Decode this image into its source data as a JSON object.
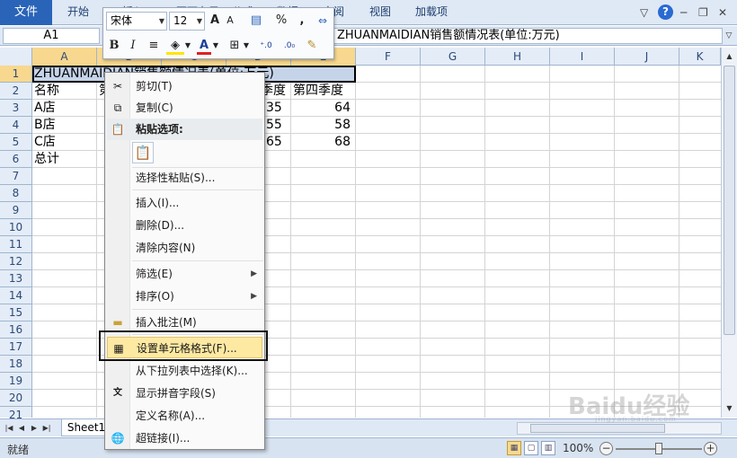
{
  "ribbon": {
    "file_tab": "文件",
    "tabs": [
      "开始",
      "插入",
      "页面布局",
      "公式",
      "数据",
      "审阅",
      "视图",
      "加载项"
    ]
  },
  "window": {
    "help_label": "?"
  },
  "formula_bar": {
    "name_box": "A1",
    "content": "ZHUANMAIDIAN销售额情况表(单位:万元)"
  },
  "grid": {
    "columns": [
      "A",
      "B",
      "C",
      "D",
      "E",
      "F",
      "G",
      "H",
      "I",
      "J",
      "K"
    ],
    "selected_columns": [
      "A",
      "B",
      "C",
      "D",
      "E"
    ],
    "rows": [
      "1",
      "2",
      "3",
      "4",
      "5",
      "6",
      "7",
      "8",
      "9",
      "10",
      "11",
      "12",
      "13",
      "14",
      "15",
      "16",
      "17",
      "18",
      "19",
      "20",
      "21"
    ],
    "selected_row": "1",
    "cells": {
      "a1": "ZHUANMAIDIAN销售额情况表(单位:万元)",
      "a2": "名称",
      "b2": "第",
      "d2": "季度",
      "e2": "第四季度",
      "a3": "A店",
      "d3": "35",
      "e3": "64",
      "a4": "B店",
      "d4": "55",
      "e4": "58",
      "a5": "C店",
      "d5": "65",
      "e5": "68",
      "a6": "总计"
    }
  },
  "sheet_tabs": [
    "Sheet1"
  ],
  "status_bar": {
    "status": "就绪",
    "zoom": "100%"
  },
  "mini_toolbar": {
    "font_name": "宋体",
    "font_size": "12",
    "grow_font": "A",
    "shrink_font": "A",
    "percent": "%",
    "comma": ","
  },
  "context_menu": {
    "cut": "剪切(T)",
    "copy": "复制(C)",
    "paste_options": "粘贴选项:",
    "paste_special": "选择性粘贴(S)...",
    "insert": "插入(I)...",
    "delete": "删除(D)...",
    "clear_contents": "清除内容(N)",
    "filter": "筛选(E)",
    "sort": "排序(O)",
    "insert_comment": "插入批注(M)",
    "format_cells": "设置单元格格式(F)...",
    "pick_from_list": "从下拉列表中选择(K)...",
    "show_phonetic": "显示拼音字段(S)",
    "define_name": "定义名称(A)...",
    "hyperlink": "超链接(I)..."
  },
  "watermark": {
    "text": "Baidu经验",
    "sub": "jingyan.baidu.com"
  },
  "colors": {
    "accent": "#2a64b8",
    "selection_header": "#f8d88e",
    "selection_fill": "#c6d4e9",
    "menu_highlight": "#fde9a2"
  }
}
